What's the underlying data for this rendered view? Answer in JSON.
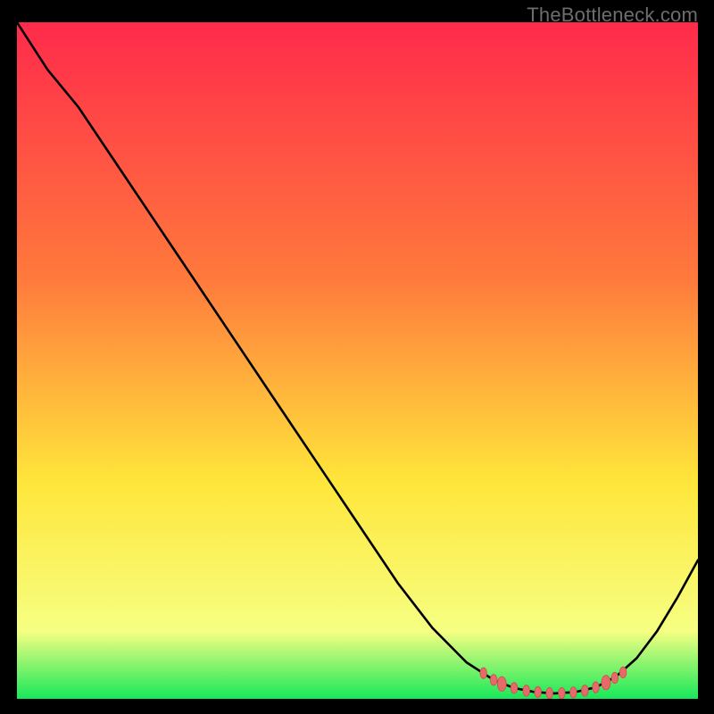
{
  "watermark": "TheBottleneck.com",
  "colors": {
    "grad_top": "#ff2a4b",
    "grad_mid1": "#ff7a3c",
    "grad_mid2": "#ffe63b",
    "grad_mid3": "#f6ff82",
    "grad_bottom": "#17e85a",
    "line": "#000000",
    "marker": "#e76a6a",
    "marker_stroke": "#d14d4d"
  },
  "chart_data": {
    "type": "line",
    "title": "",
    "xlabel": "",
    "ylabel": "",
    "xlim": [
      0,
      100
    ],
    "ylim": [
      0,
      100
    ],
    "curve": [
      {
        "x": 0.0,
        "y": 100.0
      },
      {
        "x": 4.5,
        "y": 93.0
      },
      {
        "x": 9.0,
        "y": 87.5
      },
      {
        "x": 14.0,
        "y": 80.0
      },
      {
        "x": 20.0,
        "y": 71.0
      },
      {
        "x": 26.0,
        "y": 62.0
      },
      {
        "x": 32.0,
        "y": 53.0
      },
      {
        "x": 38.0,
        "y": 44.0
      },
      {
        "x": 44.0,
        "y": 35.0
      },
      {
        "x": 50.0,
        "y": 26.0
      },
      {
        "x": 56.0,
        "y": 17.0
      },
      {
        "x": 61.0,
        "y": 10.5
      },
      {
        "x": 66.0,
        "y": 5.4
      },
      {
        "x": 70.0,
        "y": 2.8
      },
      {
        "x": 73.0,
        "y": 1.6
      },
      {
        "x": 76.0,
        "y": 1.0
      },
      {
        "x": 79.0,
        "y": 0.8
      },
      {
        "x": 82.0,
        "y": 1.0
      },
      {
        "x": 85.0,
        "y": 1.7
      },
      {
        "x": 88.0,
        "y": 3.3
      },
      {
        "x": 91.0,
        "y": 6.0
      },
      {
        "x": 94.0,
        "y": 10.0
      },
      {
        "x": 97.0,
        "y": 15.0
      },
      {
        "x": 100.0,
        "y": 20.5
      }
    ],
    "markers": [
      {
        "x": 68.5,
        "y": 3.8,
        "r": 0.9
      },
      {
        "x": 70.0,
        "y": 2.8,
        "r": 0.9
      },
      {
        "x": 71.2,
        "y": 2.2,
        "r": 1.2
      },
      {
        "x": 73.0,
        "y": 1.6,
        "r": 0.9
      },
      {
        "x": 74.8,
        "y": 1.2,
        "r": 0.9
      },
      {
        "x": 76.5,
        "y": 1.0,
        "r": 0.9
      },
      {
        "x": 78.2,
        "y": 0.85,
        "r": 0.9
      },
      {
        "x": 80.0,
        "y": 0.85,
        "r": 0.9
      },
      {
        "x": 81.7,
        "y": 0.95,
        "r": 0.9
      },
      {
        "x": 83.4,
        "y": 1.2,
        "r": 0.9
      },
      {
        "x": 85.0,
        "y": 1.7,
        "r": 0.9
      },
      {
        "x": 86.5,
        "y": 2.4,
        "r": 1.2
      },
      {
        "x": 87.8,
        "y": 3.1,
        "r": 0.9
      },
      {
        "x": 89.0,
        "y": 3.9,
        "r": 0.9
      }
    ]
  }
}
